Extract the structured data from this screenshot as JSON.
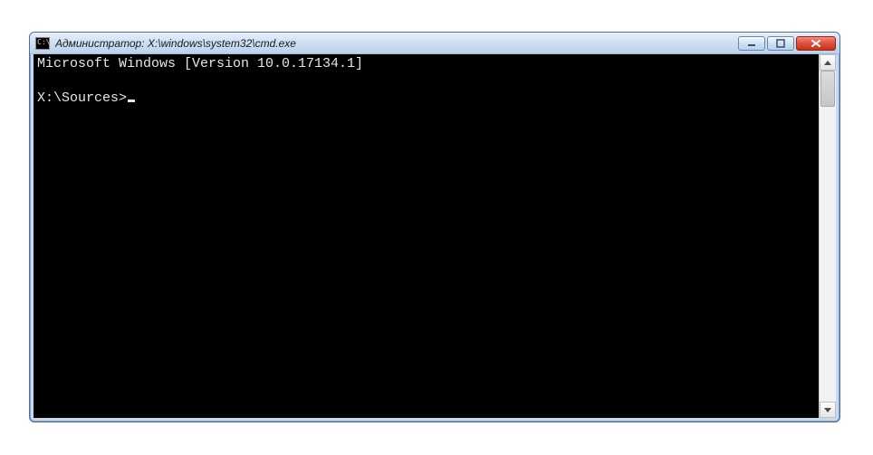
{
  "window": {
    "title": "Администратор: X:\\windows\\system32\\cmd.exe"
  },
  "console": {
    "version_line": "Microsoft Windows [Version 10.0.17134.1]",
    "blank_line": "",
    "prompt": "X:\\Sources>"
  }
}
